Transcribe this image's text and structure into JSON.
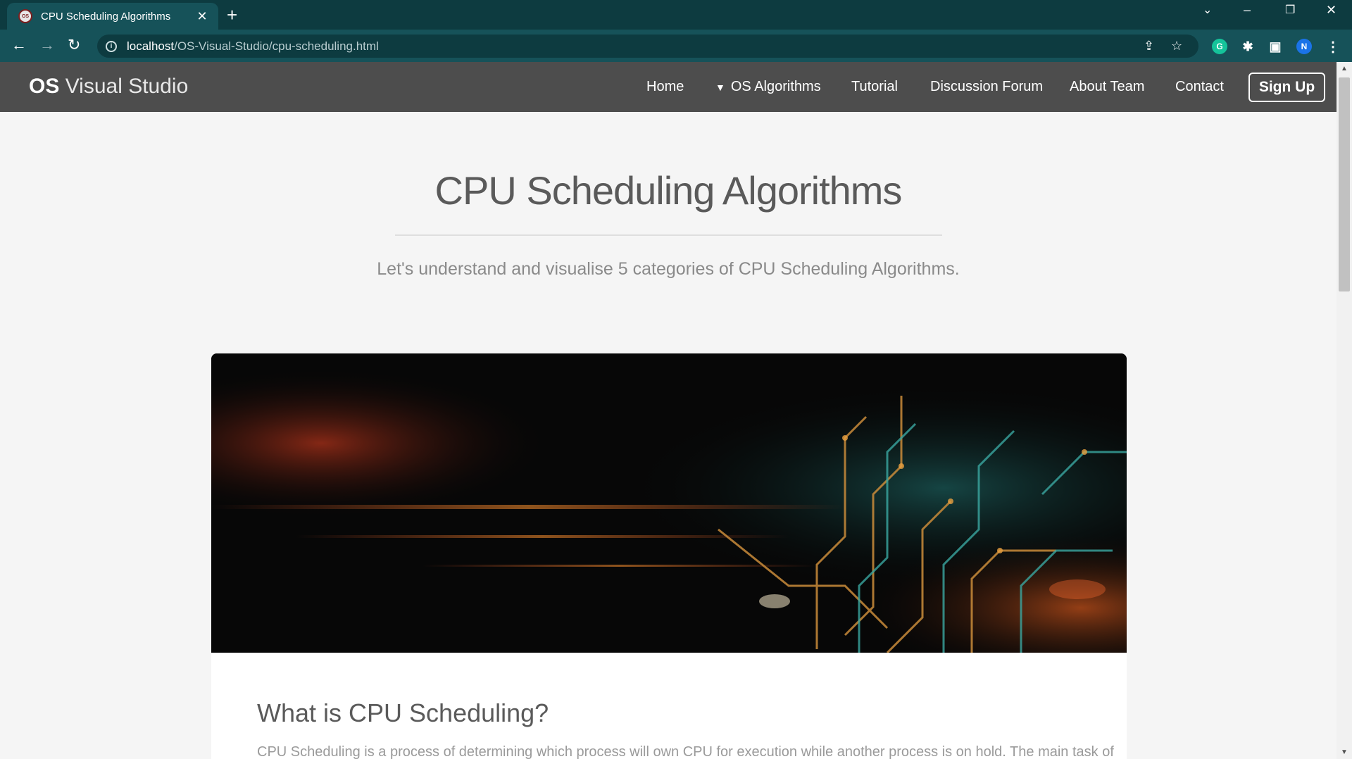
{
  "browser": {
    "tab_title": "CPU Scheduling Algorithms",
    "favicon_text": "OS",
    "url_host": "localhost",
    "url_path": "/OS-Visual-Studio/cpu-scheduling.html",
    "profile_initial": "N"
  },
  "navbar": {
    "brand_bold": "OS",
    "brand_rest": " Visual Studio",
    "items": [
      {
        "label": "Home"
      },
      {
        "label": "OS Algorithms"
      },
      {
        "label": "Tutorial"
      },
      {
        "label": "Discussion Forum"
      },
      {
        "label": "About Team"
      },
      {
        "label": "Contact"
      }
    ],
    "signup_label": "Sign Up"
  },
  "hero": {
    "title": "CPU Scheduling Algorithms",
    "subtitle": "Let's understand and visualise 5 categories of CPU Scheduling Algorithms."
  },
  "card": {
    "heading": "What is CPU Scheduling?",
    "paragraph": "CPU Scheduling is a process of determining which process will own CPU for execution while another process is on hold. The main task of"
  },
  "colors": {
    "chrome_dark": "#0d3b40",
    "chrome_tab": "#165259",
    "navbar_bg": "#4d4d4d",
    "page_bg": "#f5f5f5"
  }
}
